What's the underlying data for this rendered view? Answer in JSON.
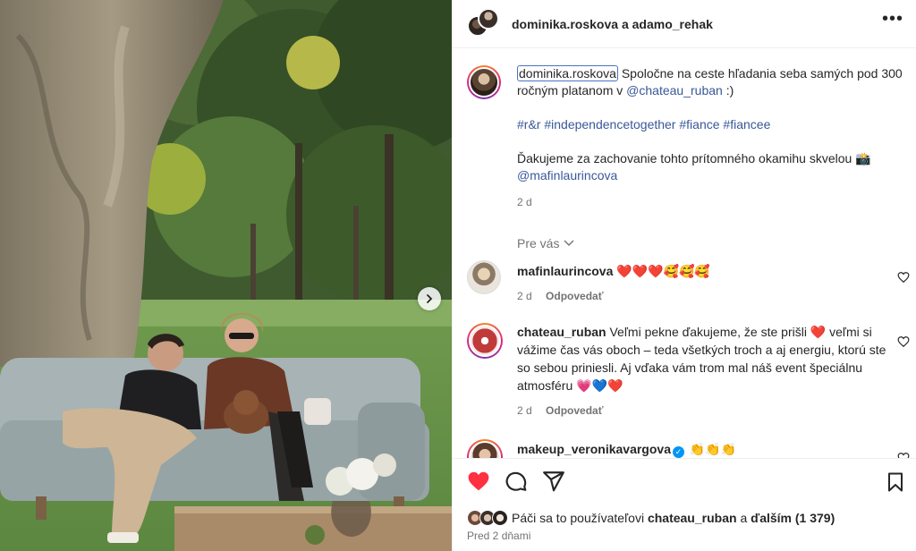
{
  "header": {
    "user1": "dominika.roskova",
    "and": "a",
    "user2": "adamo_rehak",
    "more_icon": "more-horizontal-icon"
  },
  "caption": {
    "username": "dominika.roskova",
    "text1": "Spoločne na ceste hľadania seba samých pod 300 ročným platanom v",
    "mention": "@chateau_ruban",
    "text1_end": ":)",
    "hashtags": [
      "#r&r",
      "#independencetogether",
      "#fiance",
      "#fiancee"
    ],
    "text2": "Ďakujeme za zachovanie tohto prítomného okamihu skvelou",
    "emoji_camera": "📸",
    "mention2": "@mafinlaurincova",
    "time": "2 d"
  },
  "sort_label": "Pre vás",
  "comments": [
    {
      "username": "mafinlaurincova",
      "text": "❤️❤️❤️🥰🥰🥰",
      "time": "2 d",
      "reply": "Odpovedať"
    },
    {
      "username": "chateau_ruban",
      "text": "Veľmi pekne ďakujeme, že ste prišli ❤️ veľmi si vážime čas vás oboch – teda všetkých troch a aj energiu, ktorú ste so sebou priniesli. Aj vďaka vám trom mal náš event špeciálnu atmosféru 💗💙❤️",
      "time": "2 d",
      "reply": "Odpovedať"
    },
    {
      "username": "makeup_veronikavargova",
      "text": "👏👏👏",
      "verified": true
    }
  ],
  "likes": {
    "prefix": "Páči sa to používateľovi",
    "user": "chateau_ruban",
    "middle": "a",
    "others": "ďalším (1 379)"
  },
  "posted_ago": "Pred 2 dňami",
  "colors": {
    "like_red": "#ff3040",
    "link_blue": "#385898",
    "muted_gray": "#737373"
  }
}
